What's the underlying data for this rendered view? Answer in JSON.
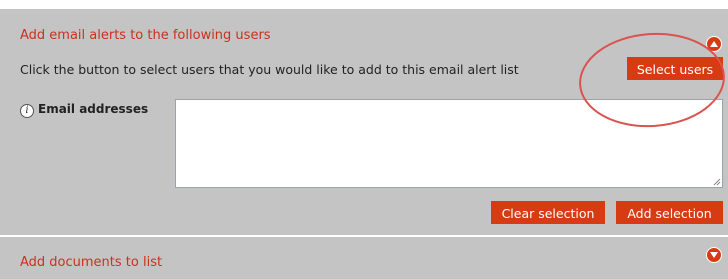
{
  "alerts_section": {
    "title": "Add email alerts to the following users",
    "instruction": "Click the button to select users that you would like to add to this email alert list",
    "select_users_label": "Select users",
    "email_label": "Email addresses",
    "email_value": "",
    "clear_selection_label": "Clear selection",
    "add_selection_label": "Add selection"
  },
  "documents_section": {
    "title": "Add documents to list"
  },
  "colors": {
    "accent": "#d73b14",
    "panel": "#c4c4c4",
    "title": "#c8321e",
    "annotation_circle": "#d9534f"
  },
  "icons": {
    "collapse": "chevron-up-icon",
    "expand": "chevron-down-icon",
    "info": "info-icon"
  }
}
